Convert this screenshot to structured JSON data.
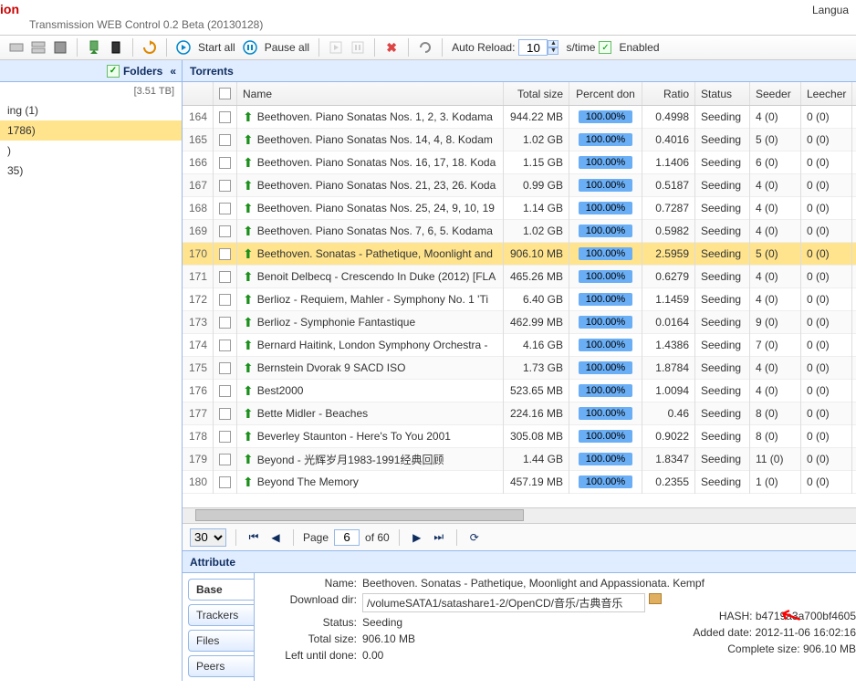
{
  "header": {
    "title_suffix": "ion",
    "subtitle": "Transmission WEB Control 0.2 Beta (20130128)",
    "language": "Langua"
  },
  "toolbar": {
    "start_all": "Start all",
    "pause_all": "Pause all",
    "auto_reload": "Auto Reload:",
    "reload_value": "10",
    "reload_unit": "s/time",
    "enabled": "Enabled"
  },
  "sidebar": {
    "title": "Folders",
    "total_size": "[3.51 TB]",
    "items": [
      {
        "label": "ing (1)",
        "selected": false
      },
      {
        "label": "1786)",
        "selected": true
      },
      {
        "label": ")",
        "selected": false
      },
      {
        "label": "35)",
        "selected": false
      }
    ]
  },
  "grid": {
    "title": "Torrents",
    "headers": {
      "num": "",
      "name": "Name",
      "size": "Total size",
      "pct": "Percent don",
      "ratio": "Ratio",
      "status": "Status",
      "seed": "Seeder",
      "leech": "Leecher"
    },
    "rows": [
      {
        "n": "164",
        "name": "Beethoven. Piano Sonatas Nos. 1, 2, 3. Kodama",
        "size": "944.22 MB",
        "pct": "100.00%",
        "ratio": "0.4998",
        "status": "Seeding",
        "seed": "4 (0)",
        "leech": "0 (0)"
      },
      {
        "n": "165",
        "name": "Beethoven. Piano Sonatas Nos. 14, 4, 8. Kodam",
        "size": "1.02 GB",
        "pct": "100.00%",
        "ratio": "0.4016",
        "status": "Seeding",
        "seed": "5 (0)",
        "leech": "0 (0)"
      },
      {
        "n": "166",
        "name": "Beethoven. Piano Sonatas Nos. 16, 17, 18. Koda",
        "size": "1.15 GB",
        "pct": "100.00%",
        "ratio": "1.1406",
        "status": "Seeding",
        "seed": "6 (0)",
        "leech": "0 (0)"
      },
      {
        "n": "167",
        "name": "Beethoven. Piano Sonatas Nos. 21, 23, 26. Koda",
        "size": "0.99 GB",
        "pct": "100.00%",
        "ratio": "0.5187",
        "status": "Seeding",
        "seed": "4 (0)",
        "leech": "0 (0)"
      },
      {
        "n": "168",
        "name": "Beethoven. Piano Sonatas Nos. 25, 24, 9, 10, 19",
        "size": "1.14 GB",
        "pct": "100.00%",
        "ratio": "0.7287",
        "status": "Seeding",
        "seed": "4 (0)",
        "leech": "0 (0)"
      },
      {
        "n": "169",
        "name": "Beethoven. Piano Sonatas Nos. 7, 6, 5. Kodama",
        "size": "1.02 GB",
        "pct": "100.00%",
        "ratio": "0.5982",
        "status": "Seeding",
        "seed": "4 (0)",
        "leech": "0 (0)"
      },
      {
        "n": "170",
        "name": "Beethoven. Sonatas - Pathetique, Moonlight and",
        "size": "906.10 MB",
        "pct": "100.00%",
        "ratio": "2.5959",
        "status": "Seeding",
        "seed": "5 (0)",
        "leech": "0 (0)",
        "sel": true
      },
      {
        "n": "171",
        "name": "Benoit Delbecq - Crescendo In Duke (2012) [FLA",
        "size": "465.26 MB",
        "pct": "100.00%",
        "ratio": "0.6279",
        "status": "Seeding",
        "seed": "4 (0)",
        "leech": "0 (0)"
      },
      {
        "n": "172",
        "name": "Berlioz - Requiem, Mahler - Symphony No. 1 'Ti",
        "size": "6.40 GB",
        "pct": "100.00%",
        "ratio": "1.1459",
        "status": "Seeding",
        "seed": "4 (0)",
        "leech": "0 (0)"
      },
      {
        "n": "173",
        "name": "Berlioz - Symphonie Fantastique",
        "size": "462.99 MB",
        "pct": "100.00%",
        "ratio": "0.0164",
        "status": "Seeding",
        "seed": "9 (0)",
        "leech": "0 (0)"
      },
      {
        "n": "174",
        "name": "Bernard Haitink, London Symphony Orchestra -",
        "size": "4.16 GB",
        "pct": "100.00%",
        "ratio": "1.4386",
        "status": "Seeding",
        "seed": "7 (0)",
        "leech": "0 (0)"
      },
      {
        "n": "175",
        "name": "Bernstein Dvorak 9 SACD ISO",
        "size": "1.73 GB",
        "pct": "100.00%",
        "ratio": "1.8784",
        "status": "Seeding",
        "seed": "4 (0)",
        "leech": "0 (0)"
      },
      {
        "n": "176",
        "name": "Best2000",
        "size": "523.65 MB",
        "pct": "100.00%",
        "ratio": "1.0094",
        "status": "Seeding",
        "seed": "4 (0)",
        "leech": "0 (0)"
      },
      {
        "n": "177",
        "name": "Bette Midler - Beaches",
        "size": "224.16 MB",
        "pct": "100.00%",
        "ratio": "0.46",
        "status": "Seeding",
        "seed": "8 (0)",
        "leech": "0 (0)"
      },
      {
        "n": "178",
        "name": "Beverley Staunton - Here's To You 2001",
        "size": "305.08 MB",
        "pct": "100.00%",
        "ratio": "0.9022",
        "status": "Seeding",
        "seed": "8 (0)",
        "leech": "0 (0)"
      },
      {
        "n": "179",
        "name": "Beyond - 光辉岁月1983-1991经典回顾",
        "size": "1.44 GB",
        "pct": "100.00%",
        "ratio": "1.8347",
        "status": "Seeding",
        "seed": "11 (0)",
        "leech": "0 (0)"
      },
      {
        "n": "180",
        "name": "Beyond The Memory",
        "size": "457.19 MB",
        "pct": "100.00%",
        "ratio": "0.2355",
        "status": "Seeding",
        "seed": "1 (0)",
        "leech": "0 (0)"
      }
    ]
  },
  "pager": {
    "page_size": "30",
    "page_label": "Page",
    "current": "6",
    "of": "of 60"
  },
  "attribute": {
    "title": "Attribute",
    "tabs": [
      "Base",
      "Trackers",
      "Files",
      "Peers"
    ],
    "name_label": "Name:",
    "name_value": "Beethoven. Sonatas - Pathetique, Moonlight and Appassionata. Kempf",
    "dir_label": "Download dir:",
    "dir_value": "/volumeSATA1/satashare1-2/OpenCD/音乐/古典音乐",
    "status_label": "Status:",
    "status_value": "Seeding",
    "size_label": "Total size:",
    "size_value": "906.10 MB",
    "left_label": "Left until done:",
    "left_value": "0.00",
    "hash_label": "HASH:",
    "hash_value": "b4719a3a700bf4605",
    "added_label": "Added date:",
    "added_value": "2012-11-06 16:02:16",
    "complete_label": "Complete size:",
    "complete_value": "906.10 MB"
  }
}
